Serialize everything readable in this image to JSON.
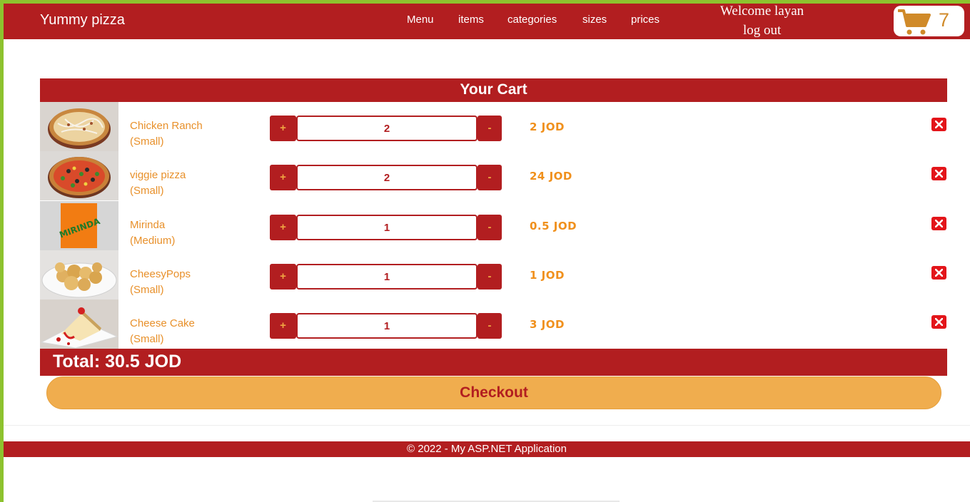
{
  "navbar": {
    "brand": "Yummy pizza",
    "links": [
      "Menu",
      "items",
      "categories",
      "sizes",
      "prices"
    ],
    "welcome": "Welcome layan",
    "logout": "log out",
    "cart_count": "7",
    "cart_icon": "cart-icon"
  },
  "cart": {
    "title": "Your Cart",
    "plus_label": "+",
    "minus_label": "-",
    "items": [
      {
        "name": "Chicken Ranch",
        "size": "(Small)",
        "qty": "2",
        "price": "2 JOD",
        "image": "chicken-ranch-pizza"
      },
      {
        "name": "viggie pizza",
        "size": "(Small)",
        "qty": "2",
        "price": "24 JOD",
        "image": "veggie-pizza"
      },
      {
        "name": "Mirinda",
        "size": "(Medium)",
        "qty": "1",
        "price": "0.5 JOD",
        "image": "mirinda-can",
        "image_text": "MIRINDA"
      },
      {
        "name": "CheesyPops",
        "size": "(Small)",
        "qty": "1",
        "price": "1 JOD",
        "image": "cheesy-pops"
      },
      {
        "name": "Cheese Cake",
        "size": "(Small)",
        "qty": "1",
        "price": "3 JOD",
        "image": "cheese-cake"
      }
    ],
    "total": "Total: 30.5 JOD",
    "checkout": "Checkout"
  },
  "footer": {
    "text": "© 2022 - My ASP.NET Application"
  },
  "colors": {
    "primary": "#b21e20",
    "accent": "#f0ad4e",
    "item_text": "#e8902a",
    "frame": "#8dc22e"
  }
}
